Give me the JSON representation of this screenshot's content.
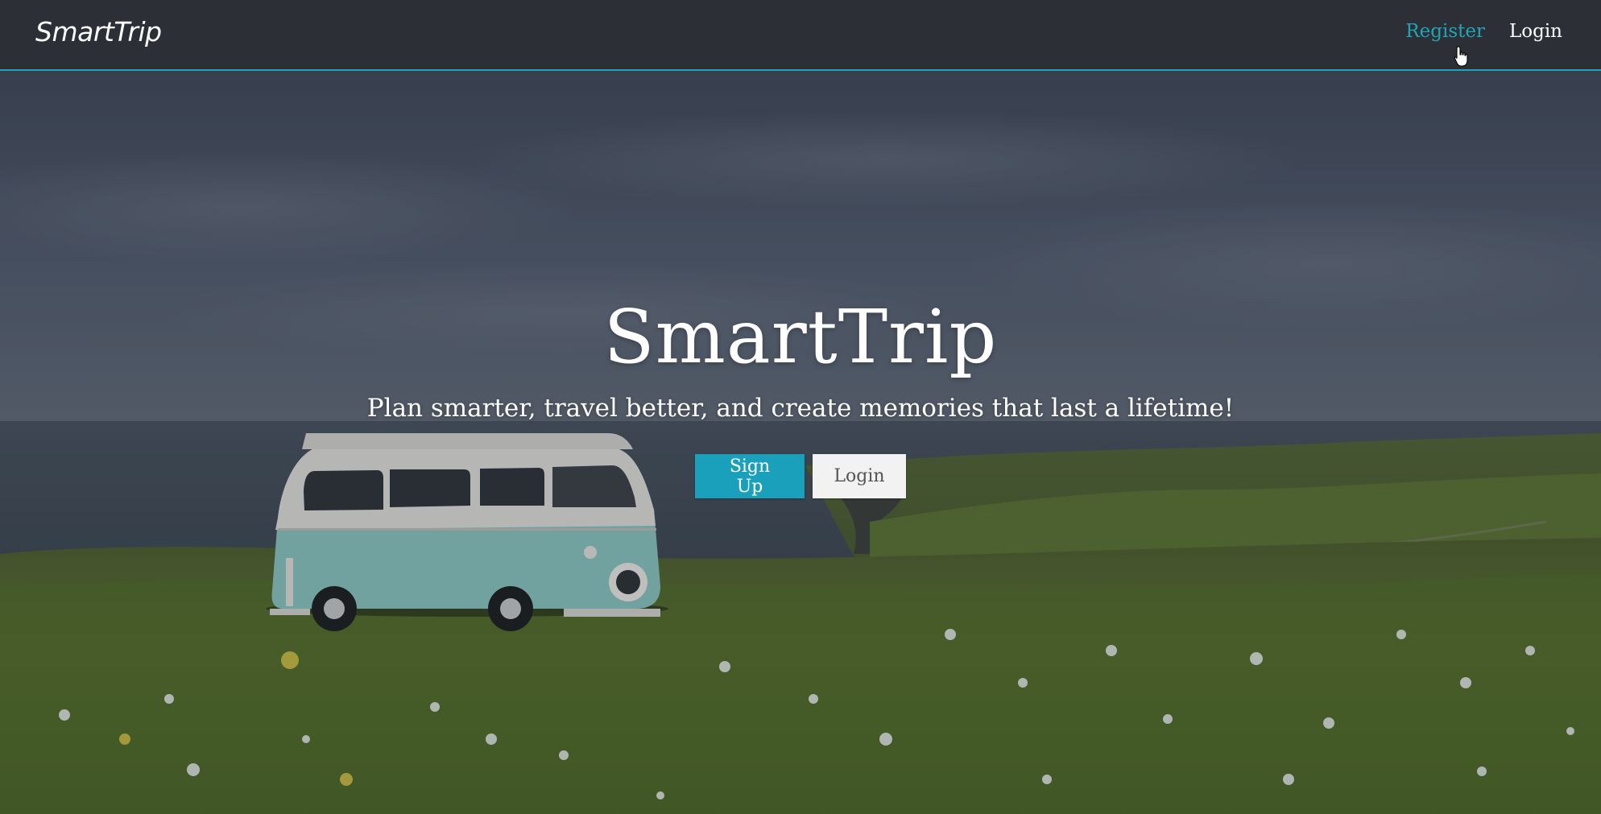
{
  "navbar": {
    "brand": "SmartTrip",
    "links": [
      {
        "label": "Register",
        "state": "active"
      },
      {
        "label": "Login",
        "state": "normal"
      }
    ]
  },
  "hero": {
    "title": "SmartTrip",
    "tagline": "Plan smarter, travel better, and create memories that last a lifetime!",
    "buttons": {
      "signup_label": "Sign Up",
      "login_label": "Login"
    }
  },
  "colors": {
    "accent": "#1aa0bb",
    "navbar_bg": "#2c3036",
    "active_link": "#22a4b6"
  },
  "icons": {
    "cursor": "hand-pointer-icon"
  }
}
